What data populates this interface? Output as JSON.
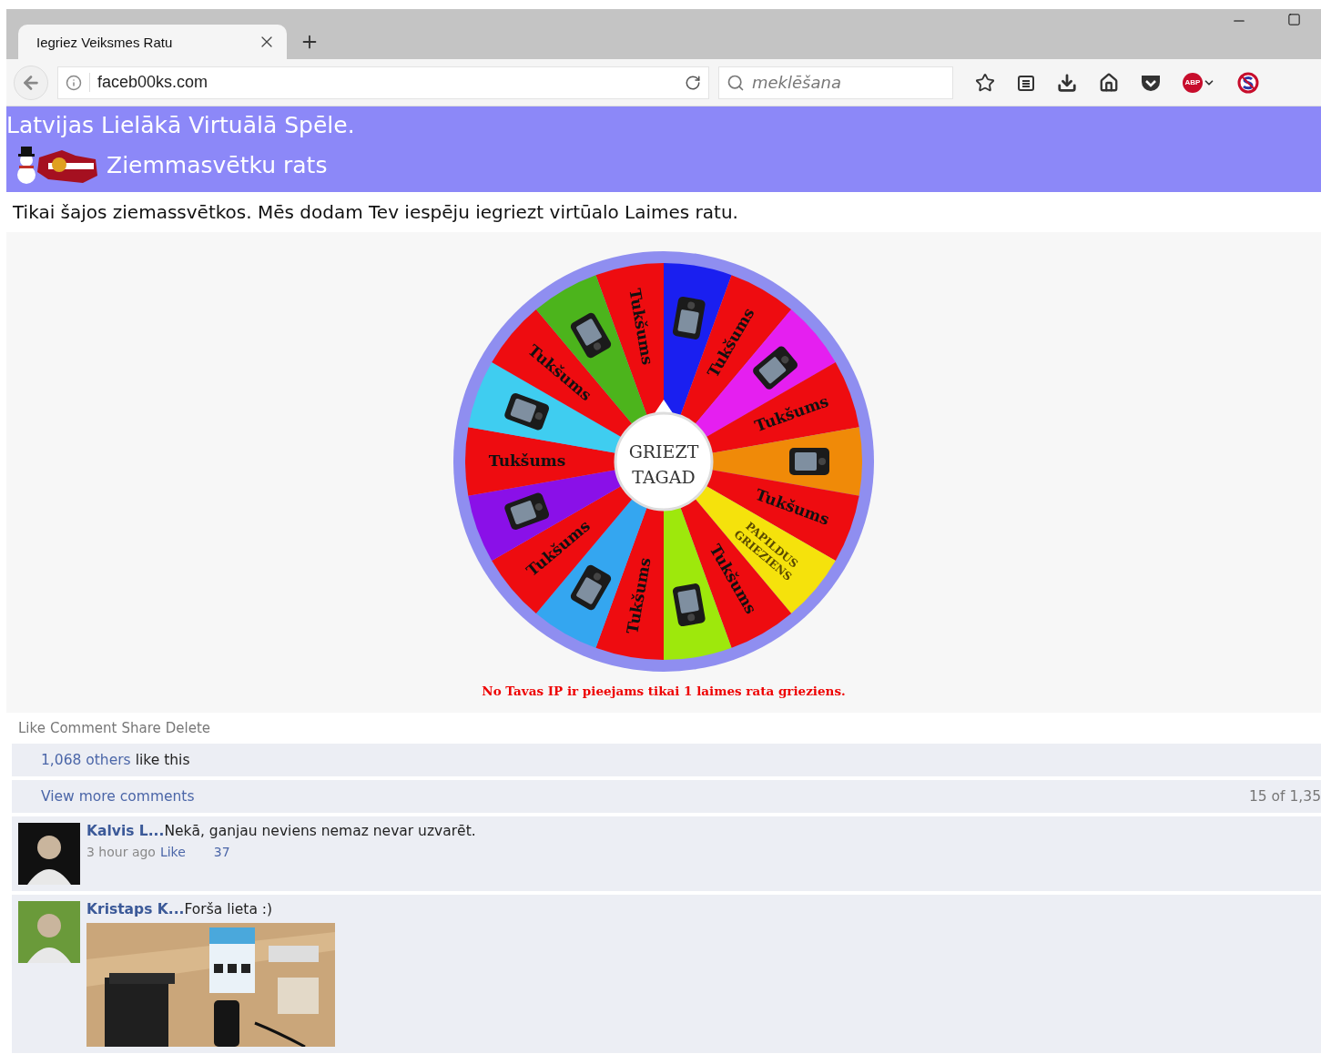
{
  "browser": {
    "tab": {
      "title": "Iegriez Veiksmes Ratu",
      "selected": true
    },
    "url": "faceb00ks.com",
    "search": {
      "placeholder": "meklēšana"
    },
    "abp_label": "ABP"
  },
  "header": {
    "title": "Latvijas Lielākā Virtuālā Spēle.",
    "subtitle": "Ziemmasvētku rats"
  },
  "intro": "Tikai šajos ziemassvētkos. Mēs dodam Tev iespēju iegriezt virtūalo Laimes ratu.",
  "wheel": {
    "button": "GRIEZT TAGAD",
    "segments": [
      {
        "kind": "text",
        "color": "#ee0c10",
        "label": "Tukšums"
      },
      {
        "kind": "prize",
        "color": "#1a1ff0"
      },
      {
        "kind": "text",
        "color": "#ee0c10",
        "label": "Tukšums"
      },
      {
        "kind": "prize",
        "color": "#e51ff0"
      },
      {
        "kind": "text",
        "color": "#ee0c10",
        "label": "Tukšums"
      },
      {
        "kind": "prize",
        "color": "#f08a08"
      },
      {
        "kind": "text",
        "color": "#ee0c10",
        "label": "Tukšums"
      },
      {
        "kind": "bonus",
        "color": "#f5e20c",
        "label": "PAPILDUS GRIEZIENS"
      },
      {
        "kind": "text",
        "color": "#ee0c10",
        "label": "Tukšums"
      },
      {
        "kind": "prize",
        "color": "#9ee80c"
      },
      {
        "kind": "text",
        "color": "#ee0c10",
        "label": "Tukšums"
      },
      {
        "kind": "prize",
        "color": "#34a6f0"
      },
      {
        "kind": "text",
        "color": "#ee0c10",
        "label": "Tukšums"
      },
      {
        "kind": "prize",
        "color": "#8a10e8"
      },
      {
        "kind": "text",
        "color": "#ee0c10",
        "label": "Tukšums"
      },
      {
        "kind": "prize",
        "color": "#3fcdf0"
      },
      {
        "kind": "text",
        "color": "#ee0c10",
        "label": "Tukšums"
      },
      {
        "kind": "prize",
        "color": "#4cb41c"
      }
    ]
  },
  "notice": "No Tavas IP ir pieejams tikai 1 laimes rata grieziens.",
  "actions": [
    "Like",
    "Comment",
    "Share",
    "Delete"
  ],
  "likes": {
    "link": "1,068 others",
    "text": "like this"
  },
  "more": {
    "link": "View more comments",
    "count": "15 of 1,35"
  },
  "comments": [
    {
      "author": "Kalvis L...",
      "text": "Nekā, ganjau neviens nemaz nevar uzvarēt.",
      "time": "3 hour ago",
      "like": "Like",
      "count": "37"
    },
    {
      "author": "Kristaps K...",
      "text": "Forša lieta :)"
    }
  ]
}
